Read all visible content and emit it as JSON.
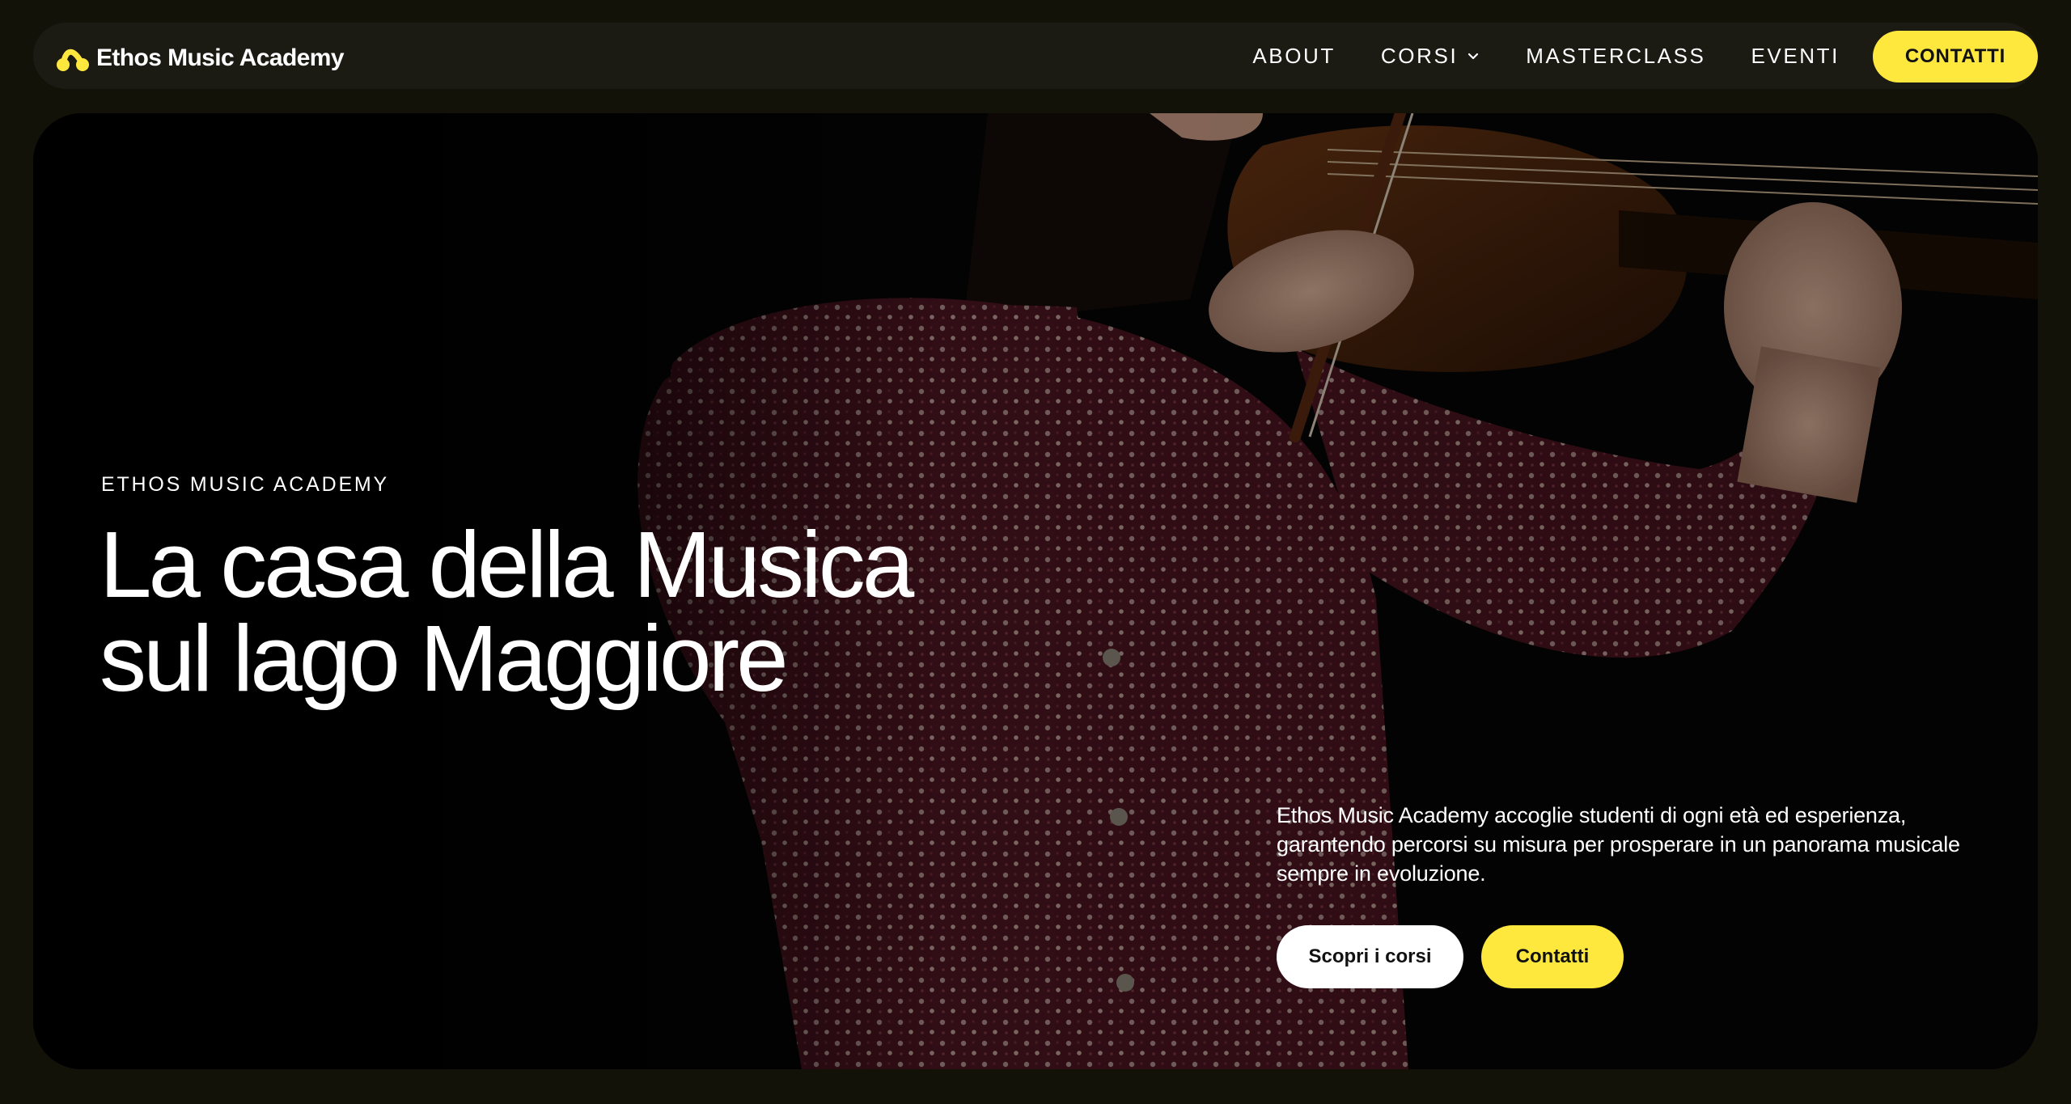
{
  "colors": {
    "accent": "#ffe83d",
    "page_background": "#121209",
    "nav_background": "#1b1b14"
  },
  "header": {
    "logo_icon": "music-note-icon",
    "brand": "Ethos Music Academy",
    "nav": [
      {
        "label": "ABOUT"
      },
      {
        "label": "CORSI",
        "icon": "chevron-down-icon"
      },
      {
        "label": "MASTERCLASS"
      },
      {
        "label": "EVENTI"
      }
    ],
    "cta_label": "CONTATTI"
  },
  "hero": {
    "image": "violinist-photo",
    "eyebrow": "ETHOS MUSIC ACADEMY",
    "title_line1": "La casa della Musica",
    "title_line2": "sul lago Maggiore",
    "description": "Ethos Music Academy accoglie studenti di ogni età ed esperienza, garantendo percorsi su misura per prosperare in un panorama musicale sempre in evoluzione.",
    "primary_button": "Scopri i corsi",
    "secondary_button": "Contatti"
  }
}
